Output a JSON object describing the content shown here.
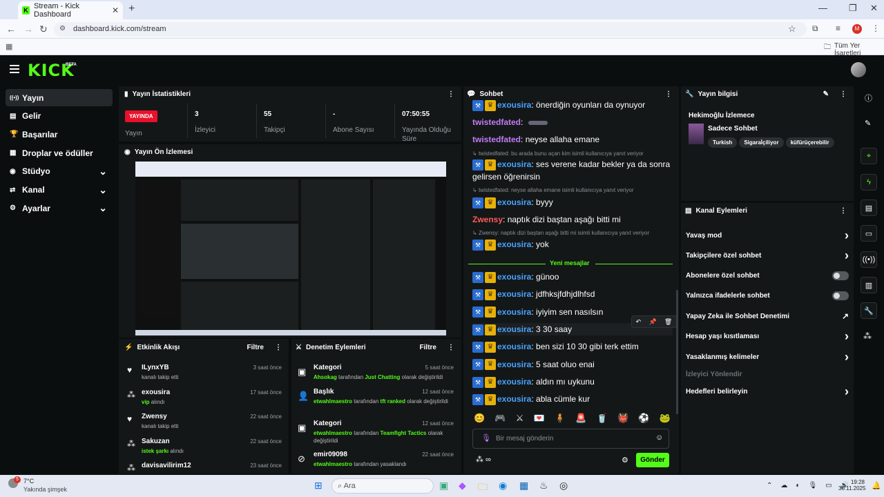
{
  "browser": {
    "tab_title": "Stream - Kick Dashboard",
    "url": "dashboard.kick.com/stream",
    "bookmarks_folder": "Tüm Yer İşaretleri",
    "profile_initial": "M"
  },
  "app": {
    "logo": "KICK",
    "logo_badge": "BETA"
  },
  "sidebar": {
    "items": [
      {
        "label": "Yayın",
        "icon": "broadcast-icon"
      },
      {
        "label": "Gelir",
        "icon": "revenue-icon"
      },
      {
        "label": "Başarılar",
        "icon": "trophy-icon"
      },
      {
        "label": "Droplar ve ödüller",
        "icon": "gift-icon"
      },
      {
        "label": "Stüdyo",
        "icon": "studio-icon"
      },
      {
        "label": "Kanal",
        "icon": "channel-icon"
      },
      {
        "label": "Ayarlar",
        "icon": "gear-icon"
      }
    ]
  },
  "stats": {
    "title": "Yayın İstatistikleri",
    "live_badge": "YAYINDA",
    "live_label": "Yayın",
    "viewers": "3",
    "viewers_label": "İzleyici",
    "followers": "55",
    "followers_label": "Takipçi",
    "subs": "-",
    "subs_label": "Abone Sayısı",
    "duration": "07:50:55",
    "duration_label": "Yayında Olduğu Süre"
  },
  "preview": {
    "title": "Yayın Ön İzlemesi"
  },
  "activity": {
    "title": "Etkinlik Akışı",
    "filter": "Filtre",
    "items": [
      {
        "name": "ILynxYB",
        "sub": "kanalı takip etti",
        "time": "3 saat önce",
        "icon": "heart-icon"
      },
      {
        "name": "exousira",
        "sub_green": "vip",
        "sub": "alındı",
        "time": "17 saat önce",
        "icon": "vip-icon"
      },
      {
        "name": "Zwensy",
        "sub": "kanalı takip etti",
        "time": "22 saat önce",
        "icon": "heart-icon"
      },
      {
        "name": "Sakuzan",
        "sub_green": "istek şarkı",
        "sub": "alındı",
        "time": "22 saat önce",
        "icon": "music-icon"
      },
      {
        "name": "davisavilirim12",
        "sub": "",
        "time": "23 saat önce",
        "icon": "event-icon"
      }
    ]
  },
  "moderation": {
    "title": "Denetim Eylemleri",
    "filter": "Filtre",
    "items": [
      {
        "title": "Kategori",
        "time": "5 saat önce",
        "actor": "Ahsokag",
        "mid": "tarafından",
        "target": "Just Chatting",
        "tail": "olarak değiştirildi"
      },
      {
        "title": "Başlık",
        "time": "12 saat önce",
        "actor": "etwahlmaestro",
        "mid": "tarafından",
        "target": "tft ranked",
        "tail": "olarak değiştirildi"
      },
      {
        "title": "Kategori",
        "time": "12 saat önce",
        "actor": "etwahlmaestro",
        "mid": "tarafından",
        "target": "Teamfight Tactics",
        "tail": "olarak değiştirildi"
      },
      {
        "title": "emir09098",
        "time": "22 saat önce",
        "actor": "etwahlmaestro",
        "mid": "tarafından yasaklandı",
        "target": "",
        "tail": ""
      }
    ]
  },
  "chat": {
    "title": "Sohbet",
    "messages": [
      {
        "user": "exousira",
        "text": "önerdiğin oyunları da oynuyor",
        "color": "#4aa3ff",
        "badges": true,
        "partial": true
      },
      {
        "user": "twistedfated",
        "text": "",
        "color": "#c07cf5",
        "badges": false,
        "emote": true
      },
      {
        "user": "twistedfated",
        "text": "neyse allaha emane",
        "color": "#c07cf5",
        "badges": false
      },
      {
        "reply": "twistedfated: bu arada bunu açan kim isimli kullanıcıya yanıt veriyor"
      },
      {
        "user": "exousira",
        "text": "ses verene kadar bekler ya da sonra gelirsen öğrenirsin",
        "color": "#4aa3ff",
        "badges": true
      },
      {
        "reply": "twistedfated: neyse allaha emane isimli kullanıcıya yanıt veriyor"
      },
      {
        "user": "exousira",
        "text": "byyy",
        "color": "#4aa3ff",
        "badges": true
      },
      {
        "user": "Zwensy",
        "text": "naptık dizi baştan aşağı bitti mi",
        "color": "#ff5a5a",
        "badges": false
      },
      {
        "reply": "Zwensy: naptık dizi baştan aşağı bitti mi isimli kullanıcıya yanıt veriyor"
      },
      {
        "user": "exousira",
        "text": "yok",
        "color": "#4aa3ff",
        "badges": true
      }
    ],
    "divider": "Yeni mesajlar",
    "new_messages": [
      {
        "user": "exousira",
        "text": "günoo"
      },
      {
        "user": "exousira",
        "text": "jdfhksjfdhjdlhfsd"
      },
      {
        "user": "exousira",
        "text": "iyiyim sen nasılsın"
      },
      {
        "user": "exousira",
        "text": "3 30 saay"
      },
      {
        "user": "exousira",
        "text": "ben sizi 10 30 gibi terk ettim"
      },
      {
        "user": "exousira",
        "text": "5 saat oluo enai"
      },
      {
        "user": "exousira",
        "text": "aldın mı uykunu"
      },
      {
        "user": "exousira",
        "text": "abla cümle kur"
      }
    ],
    "input_placeholder": "Bir mesaj gönderin",
    "send": "Gönder",
    "user_color": "#4aa3ff"
  },
  "stream_info": {
    "title": "Yayın bilgisi",
    "stream_title": "Hekimoğlu İzlemece",
    "category": "Sadece Sohbet",
    "tags": [
      "Turkish",
      "Sigaraİçiliyor",
      "küfürüçerebilir"
    ]
  },
  "channel_actions": {
    "title": "Kanal Eylemleri",
    "items": [
      {
        "label": "Yavaş mod",
        "control": "chevron"
      },
      {
        "label": "Takipçilere özel sohbet",
        "control": "chevron"
      },
      {
        "label": "Abonelere özel sohbet",
        "control": "toggle"
      },
      {
        "label": "Yalnızca ifadelerle sohbet",
        "control": "toggle"
      },
      {
        "label": "Yapay Zeka ile Sohbet Denetimi",
        "control": "external"
      },
      {
        "label": "Hesap yaşı kısıtlaması",
        "control": "chevron"
      },
      {
        "label": "Yasaklanmış kelimeler",
        "control": "chevron"
      },
      {
        "label": "İzleyici Yönlendir",
        "control": "none",
        "disabled": true
      },
      {
        "label": "Hedefleri belirleyin",
        "control": "chevron"
      }
    ]
  },
  "taskbar": {
    "weather_temp": "7°C",
    "weather_text": "Yakında şimşek",
    "weather_badge": "5",
    "search": "Ara",
    "time": "19:28",
    "date": "30.11.2025"
  },
  "colors": {
    "accent": "#53fc18",
    "live": "#e9112b"
  }
}
